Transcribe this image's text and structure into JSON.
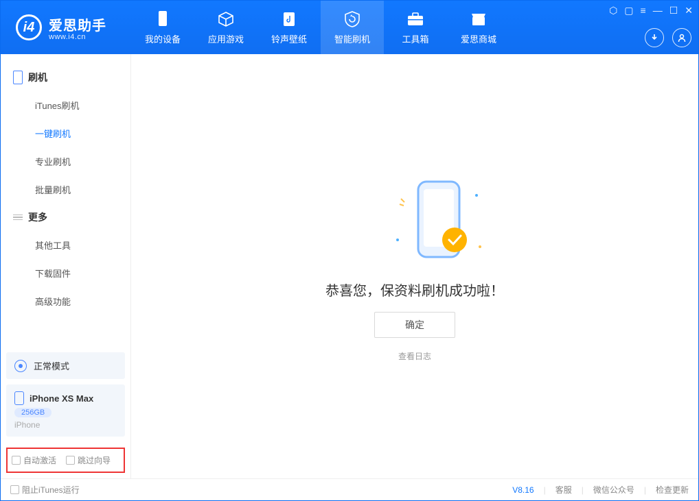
{
  "app": {
    "name": "爱思助手",
    "url": "www.i4.cn"
  },
  "tabs": [
    {
      "label": "我的设备",
      "icon": "device"
    },
    {
      "label": "应用游戏",
      "icon": "cube"
    },
    {
      "label": "铃声壁纸",
      "icon": "music"
    },
    {
      "label": "智能刷机",
      "icon": "refresh",
      "active": true
    },
    {
      "label": "工具箱",
      "icon": "toolbox"
    },
    {
      "label": "爱思商城",
      "icon": "shop"
    }
  ],
  "sidebar": {
    "group1": {
      "title": "刷机",
      "items": [
        "iTunes刷机",
        "一键刷机",
        "专业刷机",
        "批量刷机"
      ],
      "activeIndex": 1
    },
    "group2": {
      "title": "更多",
      "items": [
        "其他工具",
        "下载固件",
        "高级功能"
      ]
    }
  },
  "status": {
    "mode": "正常模式"
  },
  "device": {
    "name": "iPhone XS Max",
    "storage": "256GB",
    "type": "iPhone"
  },
  "options": {
    "autoActivate": "自动激活",
    "skipGuide": "跳过向导"
  },
  "main": {
    "message": "恭喜您，保资料刷机成功啦！",
    "okBtn": "确定",
    "logLink": "查看日志"
  },
  "footer": {
    "blockItunes": "阻止iTunes运行",
    "version": "V8.16",
    "links": [
      "客服",
      "微信公众号",
      "检查更新"
    ]
  }
}
